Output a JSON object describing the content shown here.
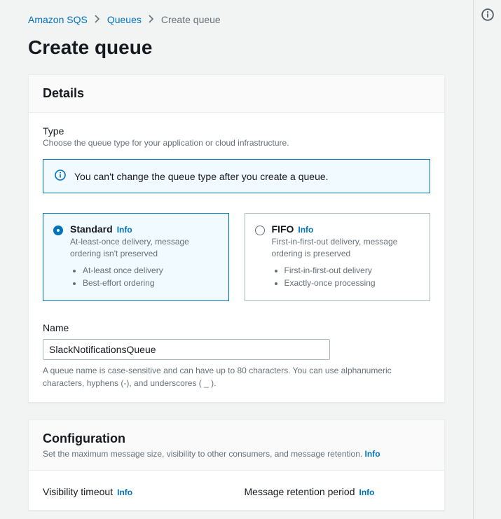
{
  "breadcrumb": {
    "items": [
      "Amazon SQS",
      "Queues"
    ],
    "current": "Create queue"
  },
  "page_title": "Create queue",
  "details": {
    "heading": "Details",
    "type_label": "Type",
    "type_desc": "Choose the queue type for your application or cloud infrastructure.",
    "alert_text": "You can't change the queue type after you create a queue.",
    "tiles": {
      "standard": {
        "title": "Standard",
        "info": "Info",
        "sub": "At-least-once delivery, message ordering isn't preserved",
        "bullets": [
          "At-least once delivery",
          "Best-effort ordering"
        ]
      },
      "fifo": {
        "title": "FIFO",
        "info": "Info",
        "sub": "First-in-first-out delivery, message ordering is preserved",
        "bullets": [
          "First-in-first-out delivery",
          "Exactly-once processing"
        ]
      }
    },
    "name_label": "Name",
    "name_value": "SlackNotificationsQueue",
    "name_helper": "A queue name is case-sensitive and can have up to 80 characters. You can use alphanumeric characters, hyphens (-), and underscores ( _ )."
  },
  "configuration": {
    "heading": "Configuration",
    "sub": "Set the maximum message size, visibility to other consumers, and message retention.",
    "info": "Info",
    "visibility_label": "Visibility timeout",
    "visibility_info": "Info",
    "retention_label": "Message retention period",
    "retention_info": "Info"
  }
}
